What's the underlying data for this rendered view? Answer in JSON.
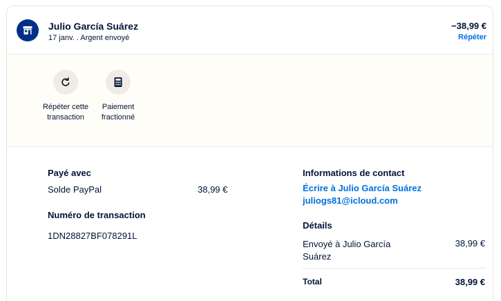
{
  "header": {
    "name": "Julio García Suárez",
    "subtitle": "17 janv. . Argent envoyé",
    "amount": "−38,99 €",
    "repeat_link": "Répéter",
    "avatar_icon": "store-icon"
  },
  "actions": [
    {
      "icon": "refresh-icon",
      "label": "Répéter cette transaction"
    },
    {
      "icon": "calculator-icon",
      "label": "Paiement fractionné"
    }
  ],
  "payment": {
    "title": "Payé avec",
    "method": "Solde PayPal",
    "amount": "38,99 €"
  },
  "transaction": {
    "title": "Numéro de transaction",
    "id": "1DN28827BF078291L"
  },
  "contact": {
    "title": "Informations de contact",
    "write_link": "Écrire à Julio García Suárez",
    "email": "juliogs81@icloud.com"
  },
  "details": {
    "title": "Détails",
    "sent_label": "Envoyé à Julio García Suárez",
    "sent_amount": "38,99 €",
    "total_label": "Total",
    "total_amount": "38,99 €"
  },
  "colors": {
    "brand": "#003087",
    "link": "#0070e0",
    "text": "#001435",
    "action_bg": "#fffdf8",
    "icon_circle": "#efece5"
  }
}
